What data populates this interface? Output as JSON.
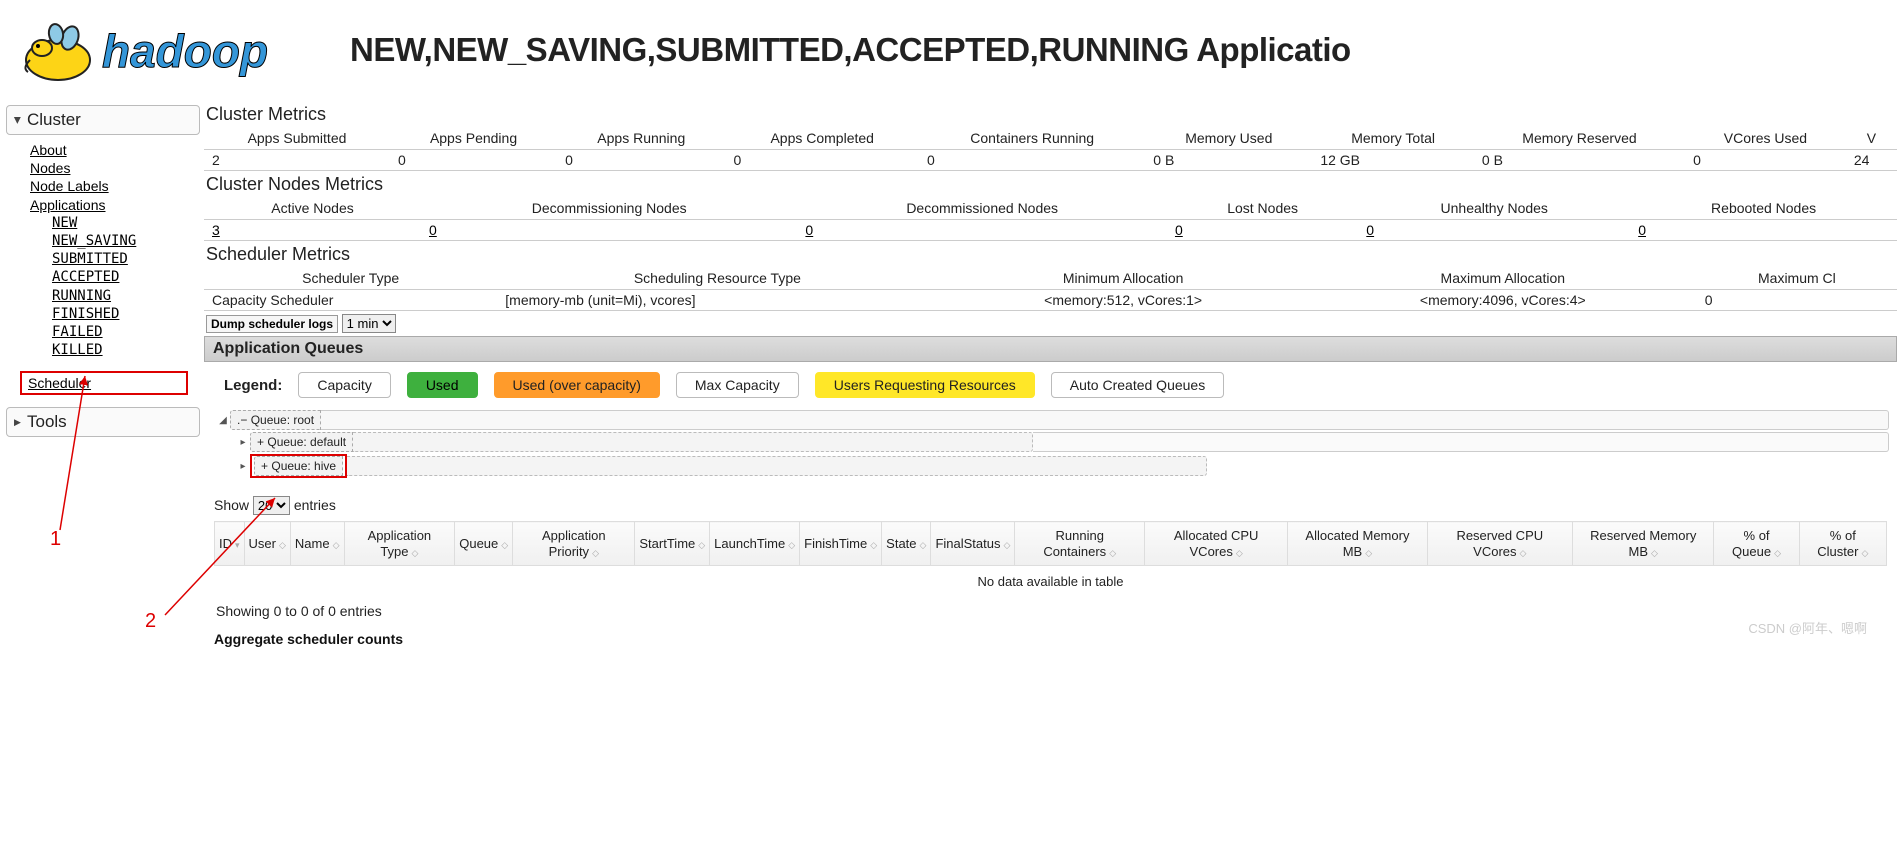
{
  "header": {
    "brand": "hadoop",
    "page_title": "NEW,NEW_SAVING,SUBMITTED,ACCEPTED,RUNNING Applicatio"
  },
  "sidebar": {
    "groups": [
      {
        "title": "Cluster",
        "collapsed": false
      },
      {
        "title": "Tools",
        "collapsed": true
      }
    ],
    "cluster_links": [
      "About",
      "Nodes",
      "Node Labels",
      "Applications"
    ],
    "app_states": [
      "NEW",
      "NEW_SAVING",
      "SUBMITTED",
      "ACCEPTED",
      "RUNNING",
      "FINISHED",
      "FAILED",
      "KILLED"
    ],
    "scheduler_link": "Scheduler"
  },
  "cluster_metrics": {
    "title": "Cluster Metrics",
    "headers": [
      "Apps Submitted",
      "Apps Pending",
      "Apps Running",
      "Apps Completed",
      "Containers Running",
      "Memory Used",
      "Memory Total",
      "Memory Reserved",
      "VCores Used",
      "V"
    ],
    "values": [
      "2",
      "0",
      "0",
      "0",
      "0",
      "0 B",
      "12 GB",
      "0 B",
      "0",
      "24"
    ]
  },
  "nodes_metrics": {
    "title": "Cluster Nodes Metrics",
    "headers": [
      "Active Nodes",
      "Decommissioning Nodes",
      "Decommissioned Nodes",
      "Lost Nodes",
      "Unhealthy Nodes",
      "Rebooted Nodes"
    ],
    "values": [
      "3",
      "0",
      "0",
      "0",
      "0",
      "0"
    ]
  },
  "scheduler_metrics": {
    "title": "Scheduler Metrics",
    "headers": [
      "Scheduler Type",
      "Scheduling Resource Type",
      "Minimum Allocation",
      "Maximum Allocation",
      "Maximum Cl"
    ],
    "values": [
      "Capacity Scheduler",
      "[memory-mb (unit=Mi), vcores]",
      "<memory:512, vCores:1>",
      "<memory:4096, vCores:4>",
      "0"
    ]
  },
  "dump": {
    "button": "Dump scheduler logs",
    "selected": "1 min"
  },
  "queues": {
    "header": "Application Queues",
    "legend_label": "Legend:",
    "legend": [
      "Capacity",
      "Used",
      "Used (over capacity)",
      "Max Capacity",
      "Users Requesting Resources",
      "Auto Created Queues"
    ],
    "tree": [
      {
        "label": "Queue: root",
        "level": 1,
        "symbol": ".−",
        "expanded": true
      },
      {
        "label": "Queue: default",
        "level": 2,
        "symbol": "+",
        "expanded": false
      },
      {
        "label": "Queue: hive",
        "level": 2,
        "symbol": "+",
        "expanded": false
      }
    ]
  },
  "apps_table": {
    "show_label_pre": "Show",
    "show_value": "20",
    "show_label_post": "entries",
    "columns": [
      "ID",
      "User",
      "Name",
      "Application Type",
      "Queue",
      "Application Priority",
      "StartTime",
      "LaunchTime",
      "FinishTime",
      "State",
      "FinalStatus",
      "Running Containers",
      "Allocated CPU VCores",
      "Allocated Memory MB",
      "Reserved CPU VCores",
      "Reserved Memory MB",
      "% of Queue",
      "% of Cluster"
    ],
    "empty_msg": "No data available in table",
    "footer": "Showing 0 to 0 of 0 entries"
  },
  "bottom_cut": "Aggregate scheduler counts",
  "watermark": "CSDN @阿年、嗯啊",
  "annotations": {
    "one": "1",
    "two": "2"
  }
}
